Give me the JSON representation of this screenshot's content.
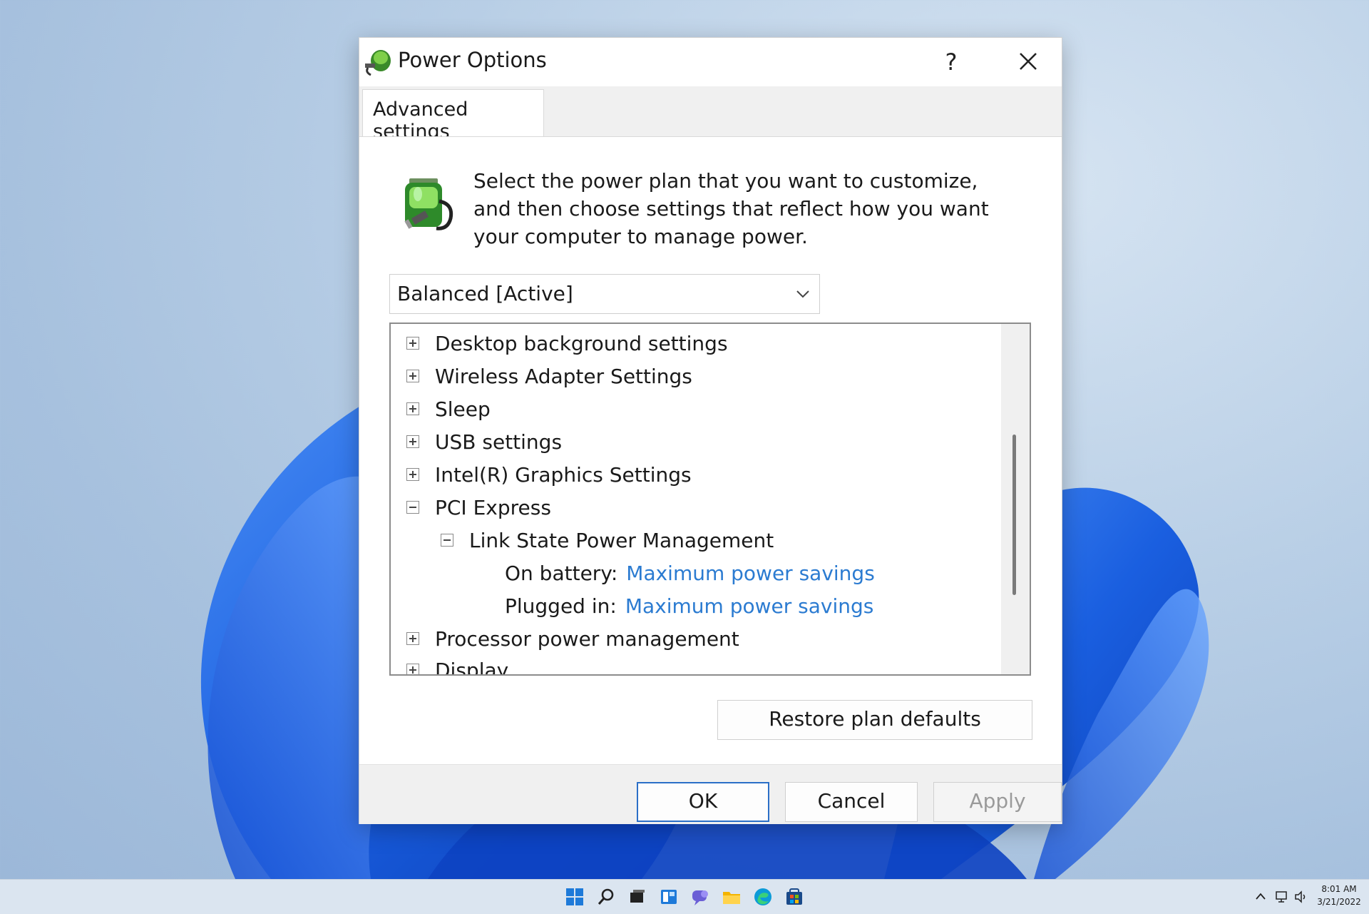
{
  "window": {
    "title": "Power Options",
    "help_label": "?",
    "tab_label": "Advanced settings"
  },
  "panel": {
    "intro_text": "Select the power plan that you want to customize, and then choose settings that reflect how you want your computer to manage power.",
    "plan_selected": "Balanced [Active]"
  },
  "tree": {
    "items": [
      {
        "label": "Desktop background settings"
      },
      {
        "label": "Wireless Adapter Settings"
      },
      {
        "label": "Sleep"
      },
      {
        "label": "USB settings"
      },
      {
        "label": "Intel(R) Graphics Settings"
      },
      {
        "label": "PCI Express"
      },
      {
        "label": "Link State Power Management"
      },
      {
        "label": "Processor power management"
      },
      {
        "label": "Display"
      }
    ],
    "settings": [
      {
        "label": "On battery:",
        "value": "Maximum power savings"
      },
      {
        "label": "Plugged in:",
        "value": "Maximum power savings"
      }
    ]
  },
  "buttons": {
    "restore": "Restore plan defaults",
    "ok": "OK",
    "cancel": "Cancel",
    "apply": "Apply"
  },
  "taskbar": {
    "time": "8:01 AM",
    "date": "3/21/2022"
  },
  "colors": {
    "accent": "#2b6fc7",
    "link": "#2b7bd1",
    "wallpaper_bloom": "#1a5fe0"
  }
}
